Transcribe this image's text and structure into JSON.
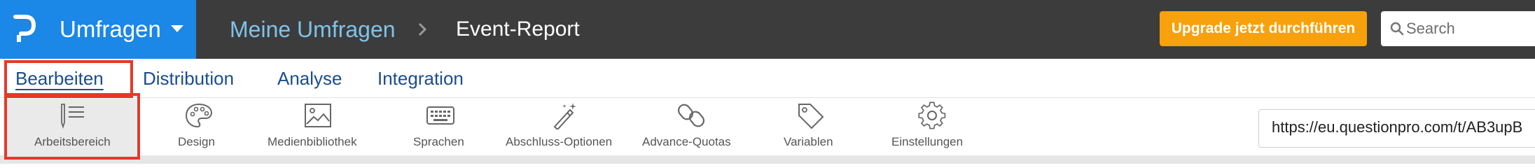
{
  "app": {
    "title": "Umfragen"
  },
  "breadcrumb": {
    "parent": "Meine Umfragen",
    "current": "Event-Report"
  },
  "header": {
    "upgrade_label": "Upgrade jetzt durchführen",
    "search_placeholder": "Search"
  },
  "tabs": [
    {
      "label": "Bearbeiten",
      "active": true
    },
    {
      "label": "Distribution",
      "active": false
    },
    {
      "label": "Analyse",
      "active": false
    },
    {
      "label": "Integration",
      "active": false
    }
  ],
  "toolbar": {
    "items": [
      {
        "label": "Arbeitsbereich",
        "icon": "workspace-list-icon",
        "active": true
      },
      {
        "label": "Design",
        "icon": "palette-icon",
        "active": false
      },
      {
        "label": "Medienbibliothek",
        "icon": "image-icon",
        "active": false
      },
      {
        "label": "Sprachen",
        "icon": "keyboard-icon",
        "active": false
      },
      {
        "label": "Abschluss-Optionen",
        "icon": "magic-wand-icon",
        "active": false
      },
      {
        "label": "Advance-Quotas",
        "icon": "chain-link-icon",
        "active": false
      },
      {
        "label": "Variablen",
        "icon": "tag-icon",
        "active": false
      },
      {
        "label": "Einstellungen",
        "icon": "gear-icon",
        "active": false
      }
    ],
    "url": "https://eu.questionpro.com/t/AB3upB"
  },
  "colors": {
    "brand_blue": "#1b87e6",
    "topbar_bg": "#3c3c3c",
    "upgrade_orange": "#f7a10c",
    "tab_text": "#1a4d8f",
    "highlight_red": "#e8372a"
  }
}
